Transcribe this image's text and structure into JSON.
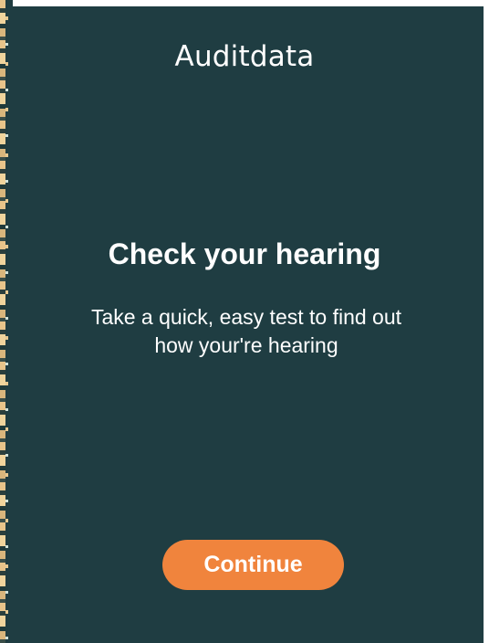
{
  "app": {
    "brand_name": "Auditdata"
  },
  "screen": {
    "title": "Check your hearing",
    "description": "Take a quick, easy test to find out how your're hearing"
  },
  "actions": {
    "continue_label": "Continue"
  },
  "colors": {
    "background": "#1f3d42",
    "accent": "#f0843d",
    "text": "#ffffff"
  }
}
